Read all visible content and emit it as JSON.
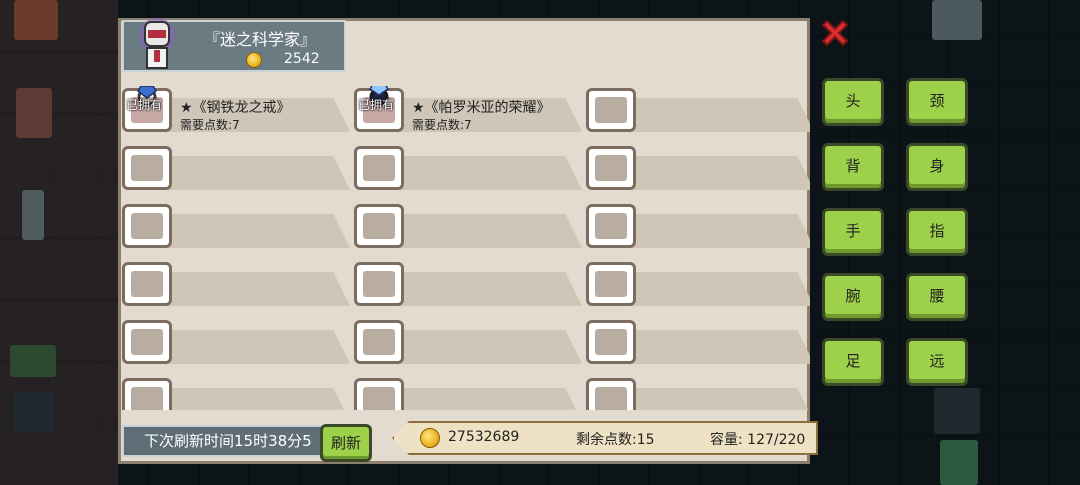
{
  "profile": {
    "name": "『迷之科学家』",
    "gold": "2542"
  },
  "items": [
    {
      "owned_badge": "已拥有",
      "name": "★《钢铁龙之戒》",
      "requirement": "需要点数:7",
      "gem_color": "#3c6fd0"
    },
    {
      "owned_badge": "已拥有",
      "name": "★《帕罗米亚的荣耀》",
      "requirement": "需要点数:7",
      "gem_color": "#2a2f6b"
    }
  ],
  "footer": {
    "refresh_timer": "下次刷新时间15时38分5",
    "refresh_label": "刷新",
    "total_gold": "27532689",
    "remaining_points": "剩余点数:15",
    "capacity": "容量:  127/220"
  },
  "equipment_slots": [
    "头",
    "颈",
    "背",
    "身",
    "手",
    "指",
    "腕",
    "腰",
    "足",
    "远"
  ],
  "colors": {
    "panel": "#e4dbd0",
    "button_green": "#9dd14a",
    "close_red": "#d9302f"
  }
}
